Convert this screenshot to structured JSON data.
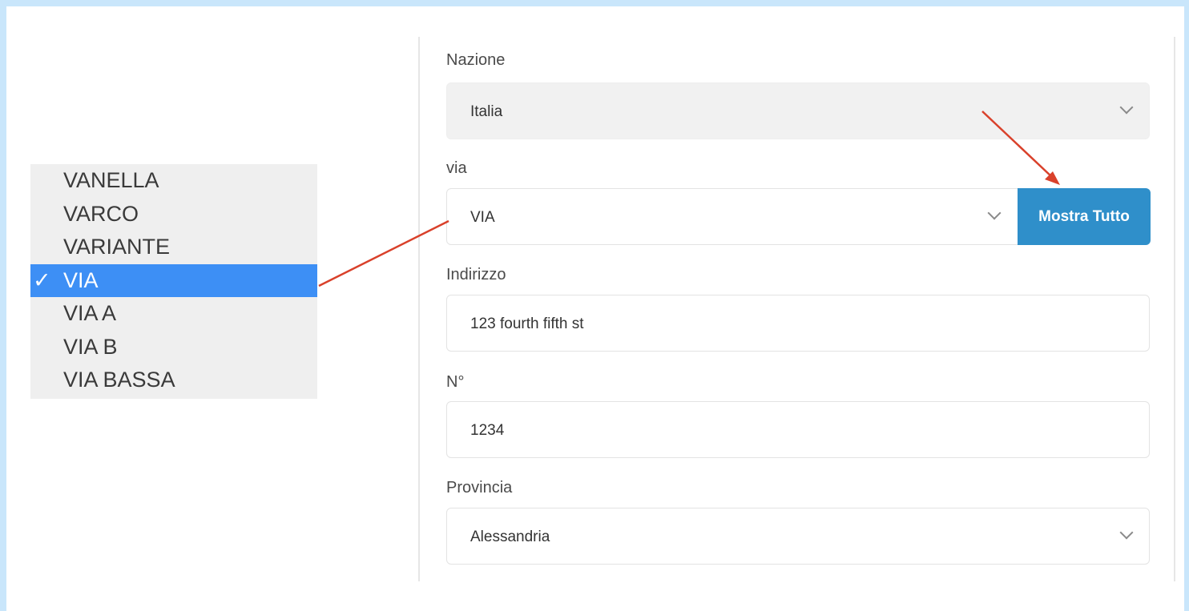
{
  "dropdown": {
    "options": [
      "VANELLA",
      "VARCO",
      "VARIANTE",
      "VIA",
      "VIA A",
      "VIA B",
      "VIA BASSA"
    ],
    "selected": "VIA",
    "check_glyph": "✓"
  },
  "form": {
    "nazione": {
      "label": "Nazione",
      "value": "Italia"
    },
    "via": {
      "label": "via",
      "value": "VIA",
      "button": "Mostra Tutto"
    },
    "indirizzo": {
      "label": "Indirizzo",
      "value": "123 fourth fifth st"
    },
    "numero": {
      "label": "N°",
      "value": "1234"
    },
    "provincia": {
      "label": "Provincia",
      "value": "Alessandria"
    }
  },
  "colors": {
    "selection": "#3d8ff5",
    "button": "#2f8fca",
    "annotation_arrow": "#d9412b",
    "frame": "#c9e6fb"
  },
  "icons": [
    "check-icon",
    "chevron-down-icon",
    "annotation-arrow"
  ]
}
